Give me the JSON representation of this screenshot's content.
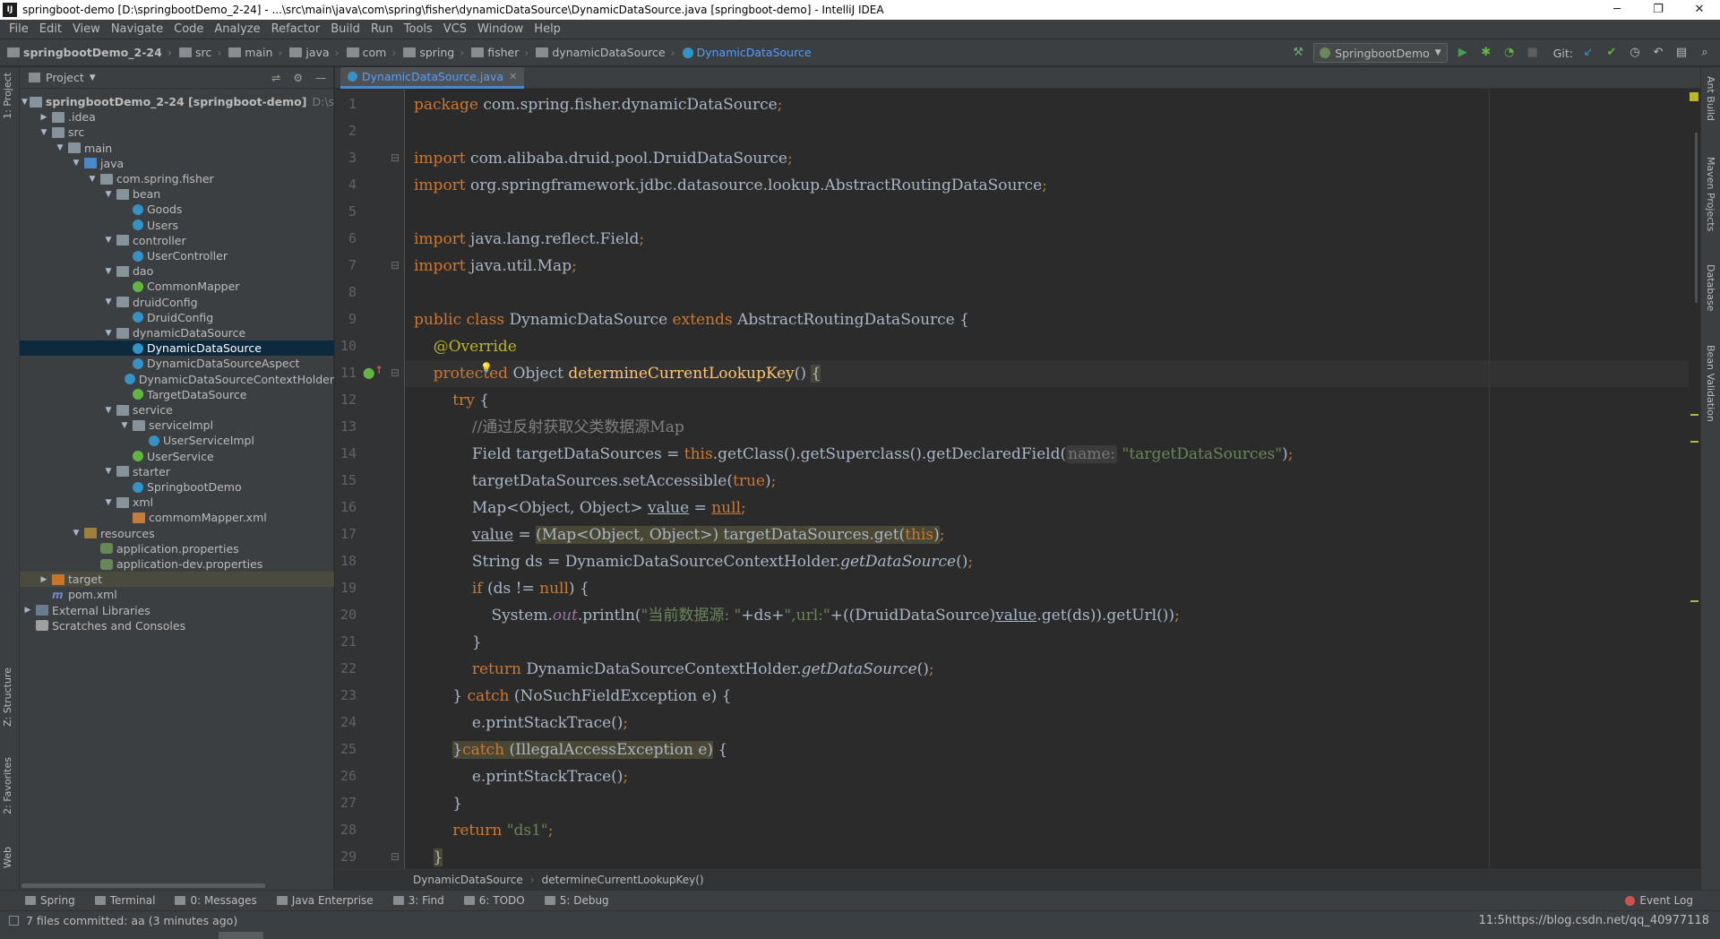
{
  "window": {
    "title": "springboot-demo [D:\\springbootDemo_2-24] - ...\\src\\main\\java\\com\\spring\\fisher\\dynamicDataSource\\DynamicDataSource.java [springboot-demo] - IntelliJ IDEA",
    "app_icon": "IJ",
    "minimize": "─",
    "restore": "❐",
    "close": "✕"
  },
  "menu": [
    "File",
    "Edit",
    "View",
    "Navigate",
    "Code",
    "Analyze",
    "Refactor",
    "Build",
    "Run",
    "Tools",
    "VCS",
    "Window",
    "Help"
  ],
  "nav": {
    "crumbs": [
      "springbootDemo_2-24",
      "src",
      "main",
      "java",
      "com",
      "spring",
      "fisher",
      "dynamicDataSource"
    ],
    "active": "DynamicDataSource",
    "run_config": "SpringbootDemo",
    "git_label": "Git:",
    "icons": [
      "hammer-icon",
      "run-icon",
      "debug-icon",
      "coverage-icon",
      "stop-icon",
      "vcs-update-icon",
      "vcs-commit-icon",
      "history-icon",
      "revert-icon",
      "project-structure-icon",
      "search-icon"
    ],
    "icon_glyphs": {
      "hammer": "⚒",
      "run": "▶",
      "debug": "✱",
      "coverage": "◔",
      "stop": "■",
      "update": "↙",
      "commit": "✔",
      "history": "◷",
      "revert": "↶",
      "structure": "▤",
      "search": "⌕"
    }
  },
  "left_stripe": {
    "project": "1: Project",
    "structure": "Z: Structure",
    "favorites": "2: Favorites",
    "web": "Web"
  },
  "right_stripe": {
    "ant": "Ant Build",
    "maven": "Maven Projects",
    "database": "Database",
    "bean": "Bean Validation"
  },
  "project_panel": {
    "title": "Project",
    "tools": [
      "⇌",
      "⚙",
      "—"
    ],
    "tree": [
      {
        "depth": 0,
        "arrow": "▼",
        "icon": "folder",
        "label": "springbootDemo_2-24 [springboot-demo]",
        "bold": true,
        "dim": "D:\\spring"
      },
      {
        "depth": 1,
        "arrow": "▶",
        "icon": "folder",
        "label": ".idea"
      },
      {
        "depth": 1,
        "arrow": "▼",
        "icon": "folder",
        "label": "src"
      },
      {
        "depth": 2,
        "arrow": "▼",
        "icon": "folder",
        "label": "main"
      },
      {
        "depth": 3,
        "arrow": "▼",
        "icon": "folder-src",
        "label": "java"
      },
      {
        "depth": 4,
        "arrow": "▼",
        "icon": "pkg",
        "label": "com.spring.fisher"
      },
      {
        "depth": 5,
        "arrow": "▼",
        "icon": "pkg",
        "label": "bean"
      },
      {
        "depth": 6,
        "arrow": "",
        "icon": "cls",
        "label": "Goods"
      },
      {
        "depth": 6,
        "arrow": "",
        "icon": "cls",
        "label": "Users"
      },
      {
        "depth": 5,
        "arrow": "▼",
        "icon": "pkg",
        "label": "controller"
      },
      {
        "depth": 6,
        "arrow": "",
        "icon": "cls",
        "label": "UserController"
      },
      {
        "depth": 5,
        "arrow": "▼",
        "icon": "pkg",
        "label": "dao"
      },
      {
        "depth": 6,
        "arrow": "",
        "icon": "iface",
        "label": "CommonMapper"
      },
      {
        "depth": 5,
        "arrow": "▼",
        "icon": "pkg",
        "label": "druidConfig"
      },
      {
        "depth": 6,
        "arrow": "",
        "icon": "cls",
        "label": "DruidConfig"
      },
      {
        "depth": 5,
        "arrow": "▼",
        "icon": "pkg",
        "label": "dynamicDataSource"
      },
      {
        "depth": 6,
        "arrow": "",
        "icon": "cls",
        "label": "DynamicDataSource",
        "selected": true
      },
      {
        "depth": 6,
        "arrow": "",
        "icon": "cls",
        "label": "DynamicDataSourceAspect"
      },
      {
        "depth": 6,
        "arrow": "",
        "icon": "cls",
        "label": "DynamicDataSourceContextHolder"
      },
      {
        "depth": 6,
        "arrow": "",
        "icon": "anno",
        "label": "TargetDataSource"
      },
      {
        "depth": 5,
        "arrow": "▼",
        "icon": "pkg",
        "label": "service"
      },
      {
        "depth": 6,
        "arrow": "▼",
        "icon": "pkg",
        "label": "serviceImpl"
      },
      {
        "depth": 7,
        "arrow": "",
        "icon": "cls",
        "label": "UserServiceImpl"
      },
      {
        "depth": 6,
        "arrow": "",
        "icon": "iface",
        "label": "UserService"
      },
      {
        "depth": 5,
        "arrow": "▼",
        "icon": "pkg",
        "label": "starter"
      },
      {
        "depth": 6,
        "arrow": "",
        "icon": "cls",
        "label": "SpringbootDemo"
      },
      {
        "depth": 5,
        "arrow": "▼",
        "icon": "pkg",
        "label": "xml"
      },
      {
        "depth": 6,
        "arrow": "",
        "icon": "xml",
        "label": "commomMapper.xml"
      },
      {
        "depth": 3,
        "arrow": "▼",
        "icon": "folder-res",
        "label": "resources"
      },
      {
        "depth": 4,
        "arrow": "",
        "icon": "props",
        "label": "application.properties"
      },
      {
        "depth": 4,
        "arrow": "",
        "icon": "props",
        "label": "application-dev.properties"
      },
      {
        "depth": 1,
        "arrow": "▶",
        "icon": "folder-target",
        "label": "target",
        "muted": true
      },
      {
        "depth": 1,
        "arrow": "",
        "icon": "mvn",
        "label": "pom.xml",
        "glyph": "m"
      },
      {
        "depth": 0,
        "arrow": "▶",
        "icon": "lib",
        "label": "External Libraries"
      },
      {
        "depth": 0,
        "arrow": "",
        "icon": "scratch",
        "label": "Scratches and Consoles"
      }
    ]
  },
  "editor": {
    "tab": {
      "label": "DynamicDataSource.java",
      "close": "✕"
    },
    "current_line": 11,
    "lines": [
      [
        [
          "kw",
          "package "
        ],
        [
          "",
          "com.spring.fisher.dynamicDataSource"
        ],
        [
          "kw",
          ";"
        ]
      ],
      [],
      [
        [
          "kw",
          "import "
        ],
        [
          "",
          "com.alibaba.druid.pool.DruidDataSource"
        ],
        [
          "kw",
          ";"
        ]
      ],
      [
        [
          "kw",
          "import "
        ],
        [
          "",
          "org.springframework.jdbc.datasource.lookup.AbstractRoutingDataSource"
        ],
        [
          "kw",
          ";"
        ]
      ],
      [],
      [
        [
          "kw",
          "import "
        ],
        [
          "",
          "java.lang.reflect.Field"
        ],
        [
          "kw",
          ";"
        ]
      ],
      [
        [
          "kw",
          "import "
        ],
        [
          "",
          "java.util.Map"
        ],
        [
          "kw",
          ";"
        ]
      ],
      [],
      [
        [
          "kw",
          "public class "
        ],
        [
          "",
          "DynamicDataSource "
        ],
        [
          "kw",
          "extends "
        ],
        [
          "",
          "AbstractRoutingDataSource {"
        ]
      ],
      [
        [
          "",
          "    "
        ],
        [
          "anno-t",
          "@Override"
        ]
      ],
      [
        [
          "",
          "    "
        ],
        [
          "kw",
          "protected "
        ],
        [
          "",
          "Object "
        ],
        [
          "fn",
          "determineCurrentLookupKey"
        ],
        [
          "",
          "() "
        ],
        [
          "hl",
          "{"
        ]
      ],
      [
        [
          "",
          "        "
        ],
        [
          "kw",
          "try "
        ],
        [
          "",
          "{"
        ]
      ],
      [
        [
          "",
          "            "
        ],
        [
          "com",
          "//通过反射获取父类数据源Map"
        ]
      ],
      [
        [
          "",
          "            Field targetDataSources = "
        ],
        [
          "kw",
          "this"
        ],
        [
          "",
          ".getClass().getSuperclass().getDeclaredField("
        ],
        [
          "hint",
          "name:"
        ],
        [
          "str",
          " \"targetDataSources\""
        ],
        [
          "",
          ")"
        ],
        [
          "kw",
          ";"
        ]
      ],
      [
        [
          "",
          "            targetDataSources.setAccessible("
        ],
        [
          "kw",
          "true"
        ],
        [
          "",
          ")"
        ],
        [
          "kw",
          ";"
        ]
      ],
      [
        [
          "",
          "            Map<Object, Object> "
        ],
        [
          "underline",
          "value"
        ],
        [
          "",
          " = "
        ],
        [
          "kw underline",
          "null"
        ],
        [
          "kw",
          ";"
        ]
      ],
      [
        [
          "",
          "            "
        ],
        [
          "underline",
          "value"
        ],
        [
          "",
          " = "
        ],
        [
          "hl",
          "(Map<Object, Object>) targetDataSources.get("
        ],
        [
          "kw hl",
          "this"
        ],
        [
          "hl",
          ")"
        ],
        [
          "kw",
          ";"
        ]
      ],
      [
        [
          "",
          "            String ds = DynamicDataSourceContextHolder."
        ],
        [
          "italic",
          "getDataSource"
        ],
        [
          "",
          "()"
        ],
        [
          "kw",
          ";"
        ]
      ],
      [
        [
          "",
          "            "
        ],
        [
          "kw",
          "if "
        ],
        [
          "",
          "(ds != "
        ],
        [
          "kw",
          "null"
        ],
        [
          "",
          ") {"
        ]
      ],
      [
        [
          "",
          "                System."
        ],
        [
          "field",
          "out"
        ],
        [
          "",
          ".println("
        ],
        [
          "str",
          "\"当前数据源: \""
        ],
        [
          "",
          "+ds+"
        ],
        [
          "str",
          "\",url:\""
        ],
        [
          "",
          "+((DruidDataSource)"
        ],
        [
          "underline",
          "value"
        ],
        [
          "",
          ".get(ds)).getUrl())"
        ],
        [
          "kw",
          ";"
        ]
      ],
      [
        [
          "",
          "            }"
        ]
      ],
      [
        [
          "",
          "            "
        ],
        [
          "kw",
          "return "
        ],
        [
          "",
          "DynamicDataSourceContextHolder."
        ],
        [
          "italic",
          "getDataSource"
        ],
        [
          "",
          "()"
        ],
        [
          "kw",
          ";"
        ]
      ],
      [
        [
          "",
          "        } "
        ],
        [
          "kw",
          "catch "
        ],
        [
          "",
          "(NoSuchFieldException e) {"
        ]
      ],
      [
        [
          "",
          "            e.printStackTrace()"
        ],
        [
          "kw",
          ";"
        ]
      ],
      [
        [
          "",
          "        "
        ],
        [
          "hl",
          "}"
        ],
        [
          "kw hl",
          "catch "
        ],
        [
          "hl",
          "(IllegalAccessException e)"
        ],
        [
          "",
          " {"
        ]
      ],
      [
        [
          "",
          "            e.printStackTrace()"
        ],
        [
          "kw",
          ";"
        ]
      ],
      [
        [
          "",
          "        }"
        ]
      ],
      [
        [
          "",
          "        "
        ],
        [
          "kw",
          "return "
        ],
        [
          "str",
          "\"ds1\""
        ],
        [
          "kw",
          ";"
        ]
      ],
      [
        [
          "",
          "    "
        ],
        [
          "hl",
          "}"
        ]
      ]
    ]
  },
  "breadcrumb": {
    "class": "DynamicDataSource",
    "method": "determineCurrentLookupKey()"
  },
  "tool_windows": [
    {
      "name": "spring",
      "label": "Spring"
    },
    {
      "name": "terminal",
      "label": "Terminal"
    },
    {
      "name": "messages",
      "label": "0: Messages"
    },
    {
      "name": "java-enterprise",
      "label": "Java Enterprise"
    },
    {
      "name": "find",
      "label": "3: Find"
    },
    {
      "name": "todo",
      "label": "6: TODO"
    },
    {
      "name": "debug",
      "label": "5: Debug"
    }
  ],
  "event_log": {
    "label": "Event Log",
    "count": "1"
  },
  "status": {
    "message": "7 files committed: aa (3 minutes ago)",
    "right": "11:5https://blog.csdn.net/qq_40977118"
  },
  "colors": {
    "accent": "#589df6",
    "selection": "#0d293e",
    "keyword": "#cc7832",
    "string": "#6a8759",
    "annotation": "#bbb529",
    "method": "#ffc66d"
  }
}
